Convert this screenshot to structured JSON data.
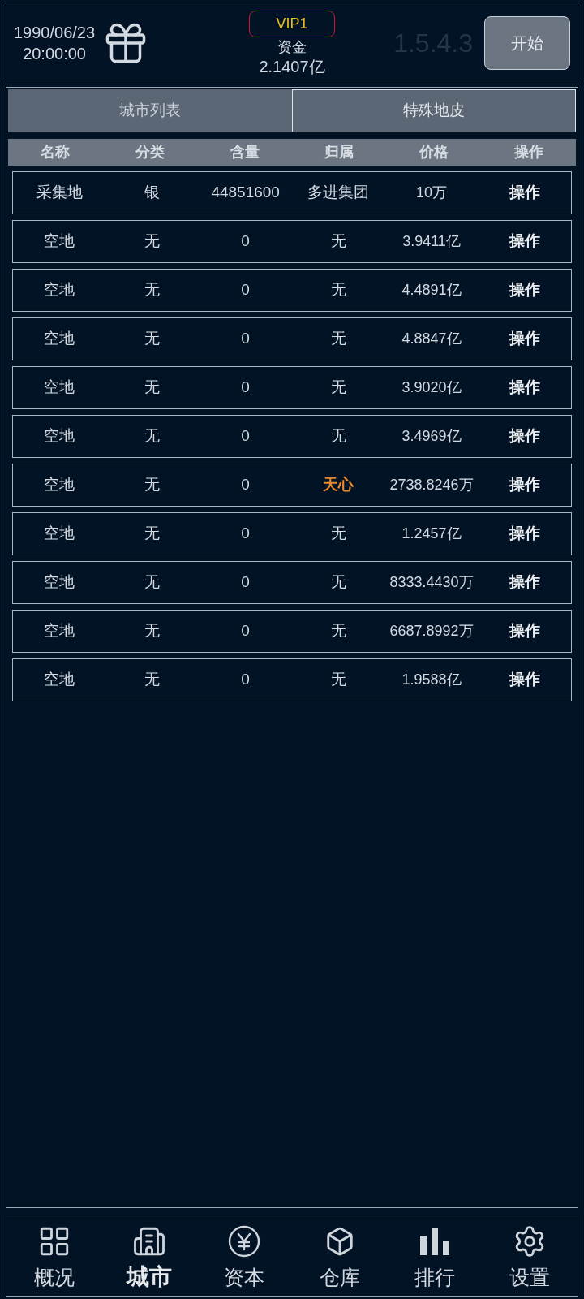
{
  "header": {
    "date": "1990/06/23",
    "time": "20:00:00",
    "vip": "VIP1",
    "funds_label": "资金",
    "funds_value": "2.1407亿",
    "version": "1.5.4.3",
    "start_button": "开始"
  },
  "tabs": [
    {
      "label": "城市列表",
      "selected": false
    },
    {
      "label": "特殊地皮",
      "selected": true
    }
  ],
  "table": {
    "columns": [
      "名称",
      "分类",
      "含量",
      "归属",
      "价格",
      "操作"
    ],
    "rows": [
      {
        "name": "采集地",
        "category": "银",
        "amount": "44851600",
        "owner": "多进集团",
        "owner_highlighted": false,
        "price": "10万",
        "action": "操作"
      },
      {
        "name": "空地",
        "category": "无",
        "amount": "0",
        "owner": "无",
        "owner_highlighted": false,
        "price": "3.9411亿",
        "action": "操作"
      },
      {
        "name": "空地",
        "category": "无",
        "amount": "0",
        "owner": "无",
        "owner_highlighted": false,
        "price": "4.4891亿",
        "action": "操作"
      },
      {
        "name": "空地",
        "category": "无",
        "amount": "0",
        "owner": "无",
        "owner_highlighted": false,
        "price": "4.8847亿",
        "action": "操作"
      },
      {
        "name": "空地",
        "category": "无",
        "amount": "0",
        "owner": "无",
        "owner_highlighted": false,
        "price": "3.9020亿",
        "action": "操作"
      },
      {
        "name": "空地",
        "category": "无",
        "amount": "0",
        "owner": "无",
        "owner_highlighted": false,
        "price": "3.4969亿",
        "action": "操作"
      },
      {
        "name": "空地",
        "category": "无",
        "amount": "0",
        "owner": "天心",
        "owner_highlighted": true,
        "price": "2738.8246万",
        "action": "操作"
      },
      {
        "name": "空地",
        "category": "无",
        "amount": "0",
        "owner": "无",
        "owner_highlighted": false,
        "price": "1.2457亿",
        "action": "操作"
      },
      {
        "name": "空地",
        "category": "无",
        "amount": "0",
        "owner": "无",
        "owner_highlighted": false,
        "price": "8333.4430万",
        "action": "操作"
      },
      {
        "name": "空地",
        "category": "无",
        "amount": "0",
        "owner": "无",
        "owner_highlighted": false,
        "price": "6687.8992万",
        "action": "操作"
      },
      {
        "name": "空地",
        "category": "无",
        "amount": "0",
        "owner": "无",
        "owner_highlighted": false,
        "price": "1.9588亿",
        "action": "操作"
      }
    ]
  },
  "nav": [
    {
      "label": "概况",
      "selected": false
    },
    {
      "label": "城市",
      "selected": true
    },
    {
      "label": "资本",
      "selected": false
    },
    {
      "label": "仓库",
      "selected": false
    },
    {
      "label": "排行",
      "selected": false
    },
    {
      "label": "设置",
      "selected": false
    }
  ]
}
